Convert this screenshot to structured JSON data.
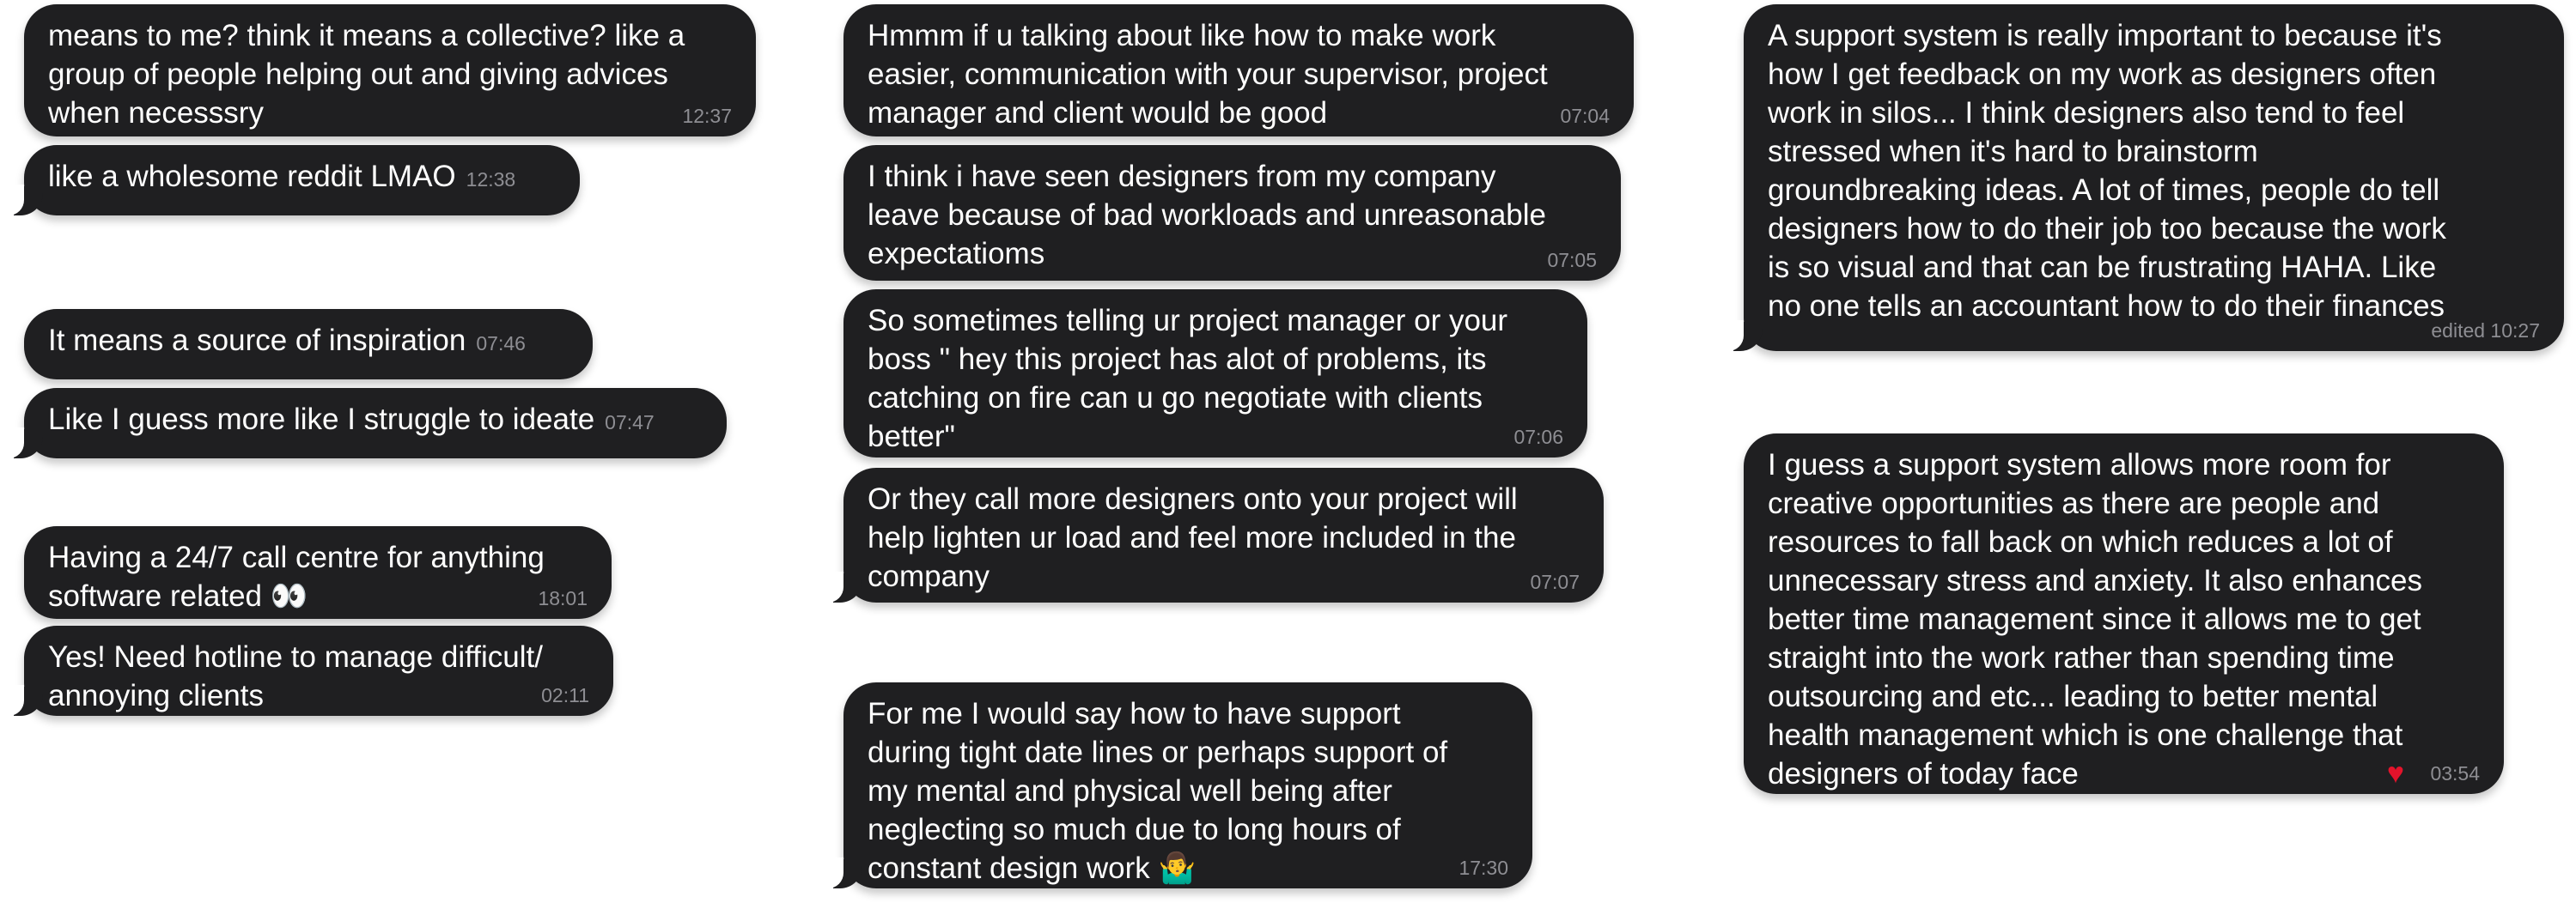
{
  "column_left": {
    "messages": [
      {
        "text": "means to me? think it means a collective? like a\ngroup of people helping out and giving advices\nwhen necesssry",
        "time": "12:37"
      },
      {
        "text": "like a wholesome reddit LMAO",
        "time": "12:38"
      },
      {
        "text": "It means a source of inspiration",
        "time": "07:46"
      },
      {
        "text": "Like I guess more like I struggle to ideate",
        "time": "07:47"
      },
      {
        "text": "Having a 24/7 call centre for anything\nsoftware related 👀",
        "time": "18:01"
      },
      {
        "text": "Yes! Need hotline to manage difficult/\nannoying clients",
        "time": "02:11"
      }
    ]
  },
  "column_middle": {
    "messages": [
      {
        "text": "Hmmm if u talking about like how to make work\neasier, communication with your supervisor, project\nmanager and client would be good",
        "time": "07:04"
      },
      {
        "text": "I think i have seen designers from my company\nleave because of bad workloads and unreasonable\nexpectatioms",
        "time": "07:05"
      },
      {
        "text": "So sometimes telling ur project manager or your\nboss \" hey this project has alot of problems, its\ncatching on fire can u go negotiate with clients\nbetter\"",
        "time": "07:06"
      },
      {
        "text": "Or they call more designers onto your project will\nhelp lighten ur load and feel more included in the\ncompany",
        "time": "07:07"
      },
      {
        "text": "For me I would say how to have support\nduring tight date lines or perhaps support of\nmy mental and physical well being after\nneglecting so much due to long hours of\nconstant design work 🤷‍♂️",
        "time": "17:30"
      }
    ]
  },
  "column_right": {
    "messages": [
      {
        "text": "A support system is really important to because it's\nhow I get feedback on my work as designers often\nwork in silos... I think designers also tend to feel\nstressed when it's hard to brainstorm\ngroundbreaking ideas. A lot of times, people do tell\ndesigners how to do their job too because the work\nis so visual and that can be frustrating HAHA. Like\nno one tells an accountant how to do their finances",
        "time": "edited 10:27"
      },
      {
        "text": "I guess a support system allows more room for\ncreative opportunities as there are people and\nresources to fall back on which reduces a lot of\nunnecessary stress and anxiety. It also enhances\nbetter time management since it allows me to get\nstraight into the work rather than spending time\noutsourcing and etc... leading to better mental\nhealth management which is one challenge that\ndesigners of today face",
        "time": "03:54",
        "reaction": "♥"
      }
    ]
  },
  "colors": {
    "bubble": "#1f1f21",
    "text": "#ffffff",
    "timestamp": "#8e8e93",
    "reaction": "#e3132b",
    "background": "#ffffff"
  }
}
